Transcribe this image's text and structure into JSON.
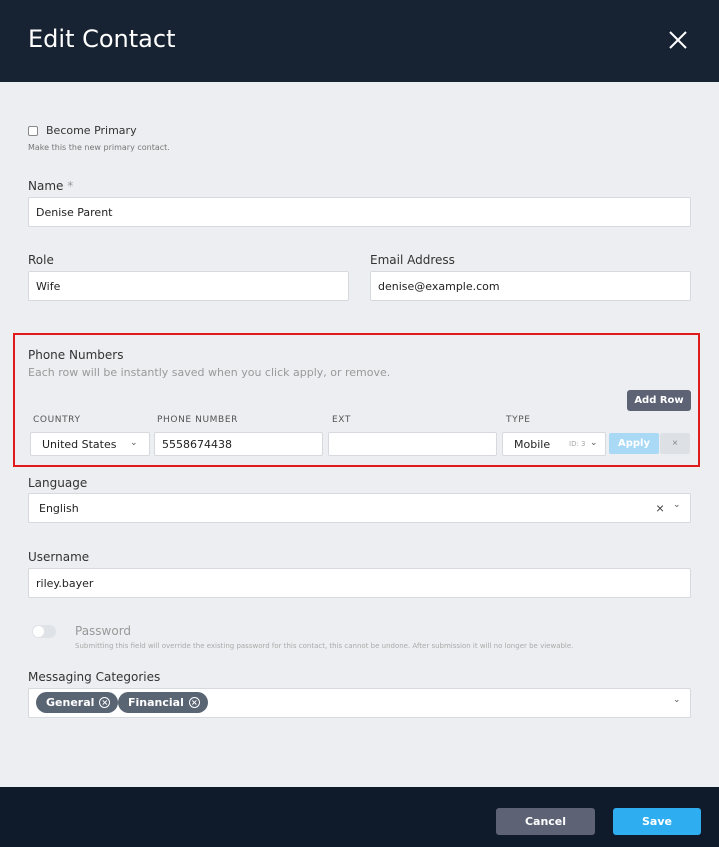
{
  "header": {
    "title": "Edit Contact",
    "close_icon": "close-icon"
  },
  "primary": {
    "label": "Become Primary",
    "hint": "Make this the new primary contact.",
    "checked": false
  },
  "name": {
    "label": "Name",
    "required_mark": "*",
    "value": "Denise Parent"
  },
  "role": {
    "label": "Role",
    "value": "Wife"
  },
  "email": {
    "label": "Email Address",
    "value": "denise@example.com"
  },
  "phones": {
    "title": "Phone Numbers",
    "hint": "Each row will be instantly saved when you click apply, or remove.",
    "add_label": "Add Row",
    "columns": {
      "country": "COUNTRY",
      "phone": "PHONE NUMBER",
      "ext": "EXT",
      "type": "TYPE"
    },
    "row": {
      "country": "United States",
      "phone": "5558674438",
      "ext": "",
      "type": "Mobile",
      "id_label": "ID: 3",
      "apply_label": "Apply",
      "remove_label": "×"
    }
  },
  "language": {
    "label": "Language",
    "value": "English",
    "clear": "×"
  },
  "username": {
    "label": "Username",
    "value": "riley.bayer"
  },
  "password": {
    "label": "Password",
    "hint": "Submitting this field will override the existing password for this contact, this cannot be undone. After submission it will no longer be viewable.",
    "enabled": false
  },
  "messaging": {
    "label": "Messaging Categories",
    "chips": [
      "General",
      "Financial"
    ],
    "chip_remove": "×"
  },
  "footer": {
    "cancel_label": "Cancel",
    "save_label": "Save"
  },
  "colors": {
    "header_bg": "#172333",
    "footer_bg": "#0f1b2b",
    "save": "#2eaef0",
    "cancel": "#5d6275",
    "highlight": "#e11b1b"
  }
}
